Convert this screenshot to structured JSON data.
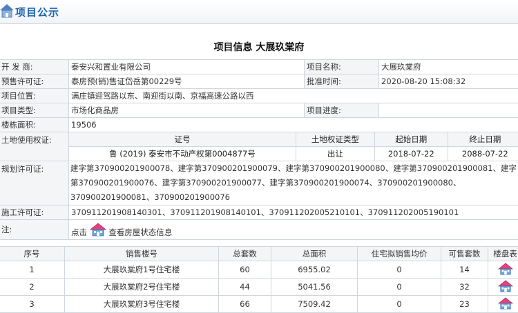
{
  "header": {
    "title": "项目公示"
  },
  "page_title": "项目信息 大展玖棠府",
  "info": {
    "developer_label": "开 发 商:",
    "developer": "泰安兴和置业有限公司",
    "project_name_label": "项目名称:",
    "project_name": "大展玖棠府",
    "presale_label": "预售许可证:",
    "presale": "泰房预(销)售证岱岳第00229号",
    "approval_time_label": "批准时间:",
    "approval_time": "2020-08-20 15:08:32",
    "location_label": "项目位置:",
    "location": "满庄镇迎驾路以东、南迎街以南、京福高速公路以西",
    "type_label": "项目类型:",
    "type": "市场化商品房",
    "progress_label": "项目进度:",
    "progress": "",
    "area_label": "楼栋面积:",
    "area": "19506",
    "land_label": "土地使用权证:",
    "land_headers": {
      "cert": "证号",
      "cert_type": "土地权证类型",
      "start": "起始日期",
      "end": "终止日期"
    },
    "land_row": {
      "cert": "鲁 (2019) 泰安市不动产权第0004877号",
      "cert_type": "出让",
      "start": "2018-07-22",
      "end": "2088-07-22"
    },
    "planning_label": "规划许可证:",
    "planning": "建字第370900201900078、建字第370900201900079、建字第370900201900080、建字第370900201900081、建字第370900201900076、建字第370900201900077、建字第370900201900074、370900201900080、370900201900081、370900201900076",
    "construction_label": "施工许可证:",
    "construction": "370911201908140301、370911201908140101、370911202005210101、370911202005190101",
    "note_label": "注:",
    "note_click": "点击",
    "note_link": "查看房屋状态信息"
  },
  "sales": {
    "headers": [
      "序号",
      "销售楼号",
      "总套数",
      "总面积",
      "住宅拟销售均价",
      "可售套数",
      "楼盘表"
    ],
    "rows": [
      [
        "1",
        "大展玖棠府1号住宅楼",
        "60",
        "6955.02",
        "0",
        "14"
      ],
      [
        "2",
        "大展玖棠府2号住宅楼",
        "44",
        "5041.56",
        "0",
        "32"
      ],
      [
        "3",
        "大展玖棠府3号住宅楼",
        "66",
        "7509.42",
        "0",
        "23"
      ]
    ]
  },
  "colors": {
    "title_blue": "#1e63b0",
    "roof_pink": "#e8417a",
    "wall_blue": "#6aa6dc"
  },
  "icons": {
    "home": "home-icon",
    "house": "house-icon"
  }
}
